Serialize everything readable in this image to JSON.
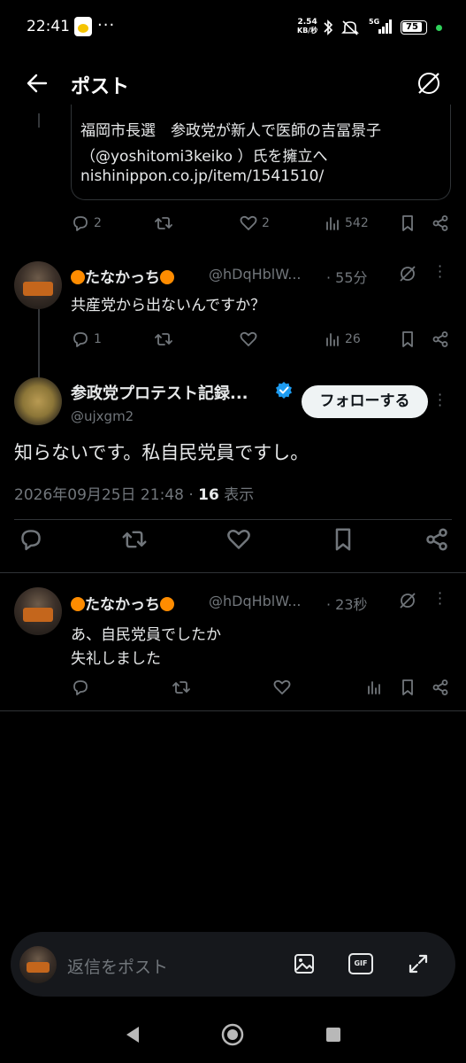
{
  "status_bar": {
    "time": "22:41",
    "dots": "···",
    "speed_value": "2.54",
    "speed_unit": "KB/秒",
    "network": "5G",
    "battery": "75",
    "icons": [
      "bluetooth-icon",
      "mute-icon",
      "wifi-icon",
      "signal-icon"
    ]
  },
  "header": {
    "title": "ポスト"
  },
  "quoted_card": {
    "line1": "福岡市長選　参政党が新人で医師の吉冨景子",
    "line2": "（@yoshitomi3keiko ）氏を擁立へ",
    "line3": "nishinippon.co.jp/item/1541510/"
  },
  "post1_actions": {
    "replies": "2",
    "likes": "2",
    "views": "542"
  },
  "reply1": {
    "name": "たなかっち",
    "handle": "@hDqHblW...",
    "time": "· 55分",
    "text": "共産党から出ないんですか？",
    "replies": "1",
    "views": "26"
  },
  "main_post": {
    "name": "参政党プロテスト記録...",
    "handle": "@ujxgm2",
    "follow_label": "フォローする",
    "text": "知らないです。私自民党員ですし。",
    "date": "2026年09月25日 21:48",
    "sep": "·",
    "views_count": "16",
    "views_label": "表示"
  },
  "reply2": {
    "name": "たなかっち",
    "handle": "@hDqHblW...",
    "time": "· 23秒",
    "text_line1": "あ、自民党員でしたか",
    "text_line2": "失礼しました"
  },
  "reply_bar": {
    "placeholder": "返信をポスト",
    "gif_label": "GIF"
  },
  "colors": {
    "background": "#000000",
    "text": "#e7e9ea",
    "muted": "#71767b",
    "verified": "#1d9bf0",
    "orange_emoji": "#ff8c00"
  }
}
